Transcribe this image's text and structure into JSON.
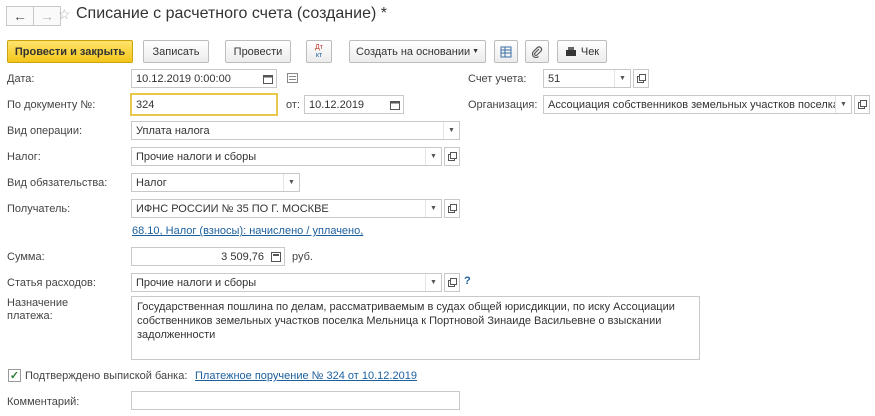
{
  "header": {
    "title": "Списание с расчетного счета (создание) *"
  },
  "toolbar": {
    "post_close": "Провести и закрыть",
    "save": "Записать",
    "post": "Провести",
    "dt_kt_top": "Дт",
    "dt_kt_bottom": "кт",
    "create_based": "Создать на основании",
    "check": "Чек"
  },
  "form": {
    "date_label": "Дата:",
    "date_value": "10.12.2019  0:00:00",
    "account_label": "Счет учета:",
    "account_value": "51",
    "docnum_label": "По документу №:",
    "docnum_value": "324",
    "from_label": "от:",
    "from_value": "10.12.2019",
    "org_label": "Организация:",
    "org_value": "Ассоциация собственников земельных участков поселка",
    "optype_label": "Вид операции:",
    "optype_value": "Уплата налога",
    "tax_label": "Налог:",
    "tax_value": "Прочие налоги и сборы",
    "obligation_label": "Вид обязательства:",
    "obligation_value": "Налог",
    "recipient_label": "Получатель:",
    "recipient_value": "ИФНС РОССИИ № 35 ПО Г. МОСКВЕ",
    "account_link": "68.10, Налог (взносы): начислено / уплачено,",
    "sum_label": "Сумма:",
    "sum_value": "3 509,76",
    "sum_currency": "руб.",
    "expense_label": "Статья расходов:",
    "expense_value": "Прочие налоги и сборы",
    "help": "?",
    "purpose_label_1": "Назначение",
    "purpose_label_2": "платежа:",
    "purpose_value": "Государственная пошлина по делам, рассматриваемым в судах общей юрисдикции, по иску Ассоциации собственников земельных участков поселка Мельница к Портновой Зинаиде Васильевне о взыскании задолженности",
    "confirmed_label": "Подтверждено выпиской банка:",
    "confirmed_link": "Платежное поручение № 324 от 10.12.2019",
    "comment_label": "Комментарий:",
    "comment_value": ""
  },
  "colors": {
    "primary": "#f4c61a",
    "link": "#1c5f9d",
    "check": "#2e7d32"
  }
}
